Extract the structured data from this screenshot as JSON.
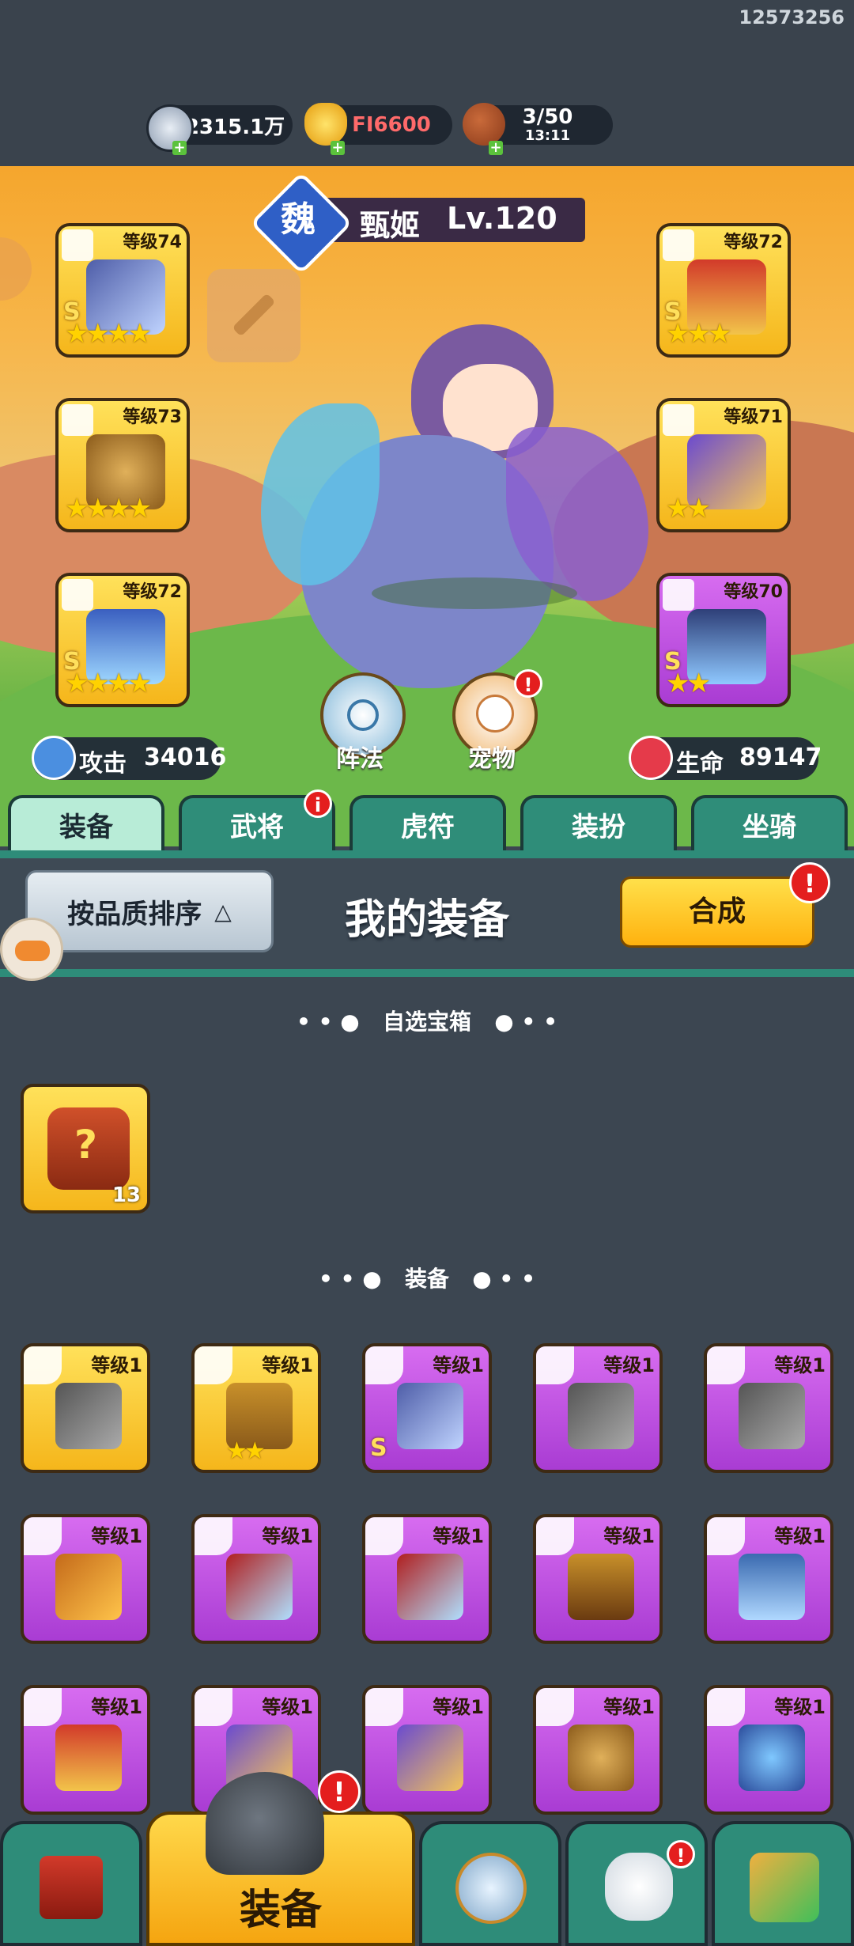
{
  "uid": "12573256",
  "resources": {
    "silver": "2315.1万",
    "gold": "FI6600",
    "stamina": "3/50",
    "stamina_timer": "13:11"
  },
  "hero": {
    "kingdom": "魏",
    "name": "甄姬",
    "level": "Lv.120",
    "attack_label": "攻击",
    "attack_value": "34016",
    "hp_label": "生命",
    "hp_value": "89147",
    "formation_label": "阵法",
    "pet_label": "宠物"
  },
  "equipped_slots": {
    "left": [
      {
        "level": "等级74",
        "stars": 4,
        "grade": "S"
      },
      {
        "level": "等级73",
        "stars": 4,
        "grade": ""
      },
      {
        "level": "等级72",
        "stars": 4,
        "grade": "S"
      }
    ],
    "right": [
      {
        "level": "等级72",
        "stars": 3,
        "grade": "S"
      },
      {
        "level": "等级71",
        "stars": 2,
        "grade": ""
      },
      {
        "level": "等级70",
        "stars": 2,
        "grade": "S"
      }
    ]
  },
  "tabs": [
    "装备",
    "武将",
    "虎符",
    "装扮",
    "坐骑"
  ],
  "panel": {
    "sort_button": "按品质排序",
    "title": "我的装备",
    "merge_button": "合成"
  },
  "sections": {
    "chest_title": "自选宝箱",
    "chest_count": "13",
    "equip_title": "装备"
  },
  "equipment": [
    {
      "level": "等级1",
      "rarity": "gold",
      "stars": 0,
      "grade": ""
    },
    {
      "level": "等级1",
      "rarity": "gold",
      "stars": 2,
      "grade": ""
    },
    {
      "level": "等级1",
      "rarity": "purple",
      "stars": 0,
      "grade": "S"
    },
    {
      "level": "等级1",
      "rarity": "purple",
      "stars": 0,
      "grade": ""
    },
    {
      "level": "等级1",
      "rarity": "purple",
      "stars": 0,
      "grade": ""
    },
    {
      "level": "等级1",
      "rarity": "purple",
      "stars": 0,
      "grade": ""
    },
    {
      "level": "等级1",
      "rarity": "purple",
      "stars": 0,
      "grade": ""
    },
    {
      "level": "等级1",
      "rarity": "purple",
      "stars": 0,
      "grade": ""
    },
    {
      "level": "等级1",
      "rarity": "purple",
      "stars": 0,
      "grade": ""
    },
    {
      "level": "等级1",
      "rarity": "purple",
      "stars": 0,
      "grade": ""
    },
    {
      "level": "等级1",
      "rarity": "purple",
      "stars": 0,
      "grade": ""
    },
    {
      "level": "等级1",
      "rarity": "purple",
      "stars": 0,
      "grade": ""
    },
    {
      "level": "等级1",
      "rarity": "purple",
      "stars": 0,
      "grade": ""
    },
    {
      "level": "等级1",
      "rarity": "purple",
      "stars": 0,
      "grade": ""
    },
    {
      "level": "等级1",
      "rarity": "purple",
      "stars": 0,
      "grade": ""
    }
  ],
  "bottom_nav": {
    "active_label": "装备"
  },
  "colors": {
    "gold_card": "#f5c21b",
    "purple_card": "#b345d9",
    "tab_active": "#b8ecd7",
    "tab_inactive": "#2f8d79",
    "merge_button": "#ffc21a",
    "alert_red": "#e41e1e"
  }
}
